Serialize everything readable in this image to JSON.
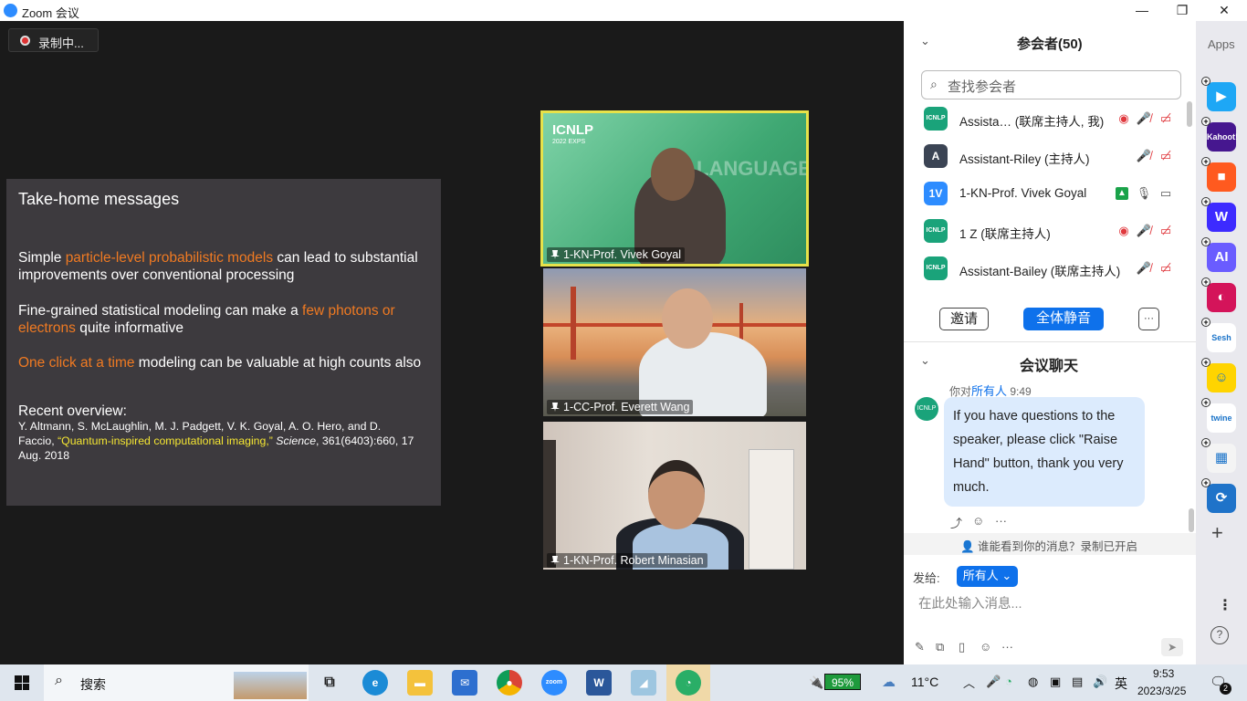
{
  "window": {
    "title": "Zoom 会议",
    "minimize": "—",
    "restore": "❐",
    "close": "✕"
  },
  "recording": {
    "label": "录制中..."
  },
  "slide": {
    "heading": "Take-home messages",
    "p1": {
      "a": "Simple ",
      "b": "particle-level probabilistic models",
      "c": " can lead to substantial improvements over conventional processing"
    },
    "p2": {
      "a": "Fine-grained statistical modeling can make a ",
      "b": "few photons or electrons",
      "c": " quite informative"
    },
    "p3": {
      "b": "One click at a time",
      "c": " modeling can be valuable at high counts also"
    },
    "overview_title": "Recent overview:",
    "ref": {
      "authors": "  Y. Altmann, S. McLaughlin, M. J. Padgett, V. K. Goyal, A. O. Hero, and D. Faccio, ",
      "title": "“Quantum-inspired computational imaging,”",
      "journal": " Science",
      "rest": ", 361(6403):660, 17 Aug. 2018"
    }
  },
  "videos": [
    {
      "label": "1-KN-Prof. Vivek Goyal",
      "banner": "ICNLP",
      "banner_year": "2022 EXPS",
      "bg_word": "LANGUAGE"
    },
    {
      "label": "1-CC-Prof. Everett Wang"
    },
    {
      "label": "1-KN-Prof. Robert Minasian"
    }
  ],
  "participants": {
    "title": "参会者(50)",
    "search_placeholder": "查找参会者",
    "list": [
      {
        "avatar": "ICNLP",
        "name": "Assista… (联席主持人, 我)",
        "color": "#1aa37a"
      },
      {
        "avatar": "A",
        "name": "Assistant-Riley (主持人)",
        "color": "#3b4454"
      },
      {
        "avatar": "1V",
        "name": "1-KN-Prof. Vivek Goyal",
        "color": "#2d8cff"
      },
      {
        "avatar": "ICNLP",
        "name": "1 Z (联席主持人)",
        "color": "#1aa37a"
      },
      {
        "avatar": "ICNLP",
        "name": "Assistant-Bailey (联席主持人)",
        "color": "#1aa37a"
      }
    ],
    "invite": "邀请",
    "mute_all": "全体静音",
    "more": "···"
  },
  "chat": {
    "title": "会议聊天",
    "from_prefix": "你对",
    "to": "所有人",
    "time": "9:49",
    "message": "If you have questions to the speaker, please click \"Raise Hand\" button, thank you very much.",
    "who_can_see": "谁能看到你的消息？录制已开启",
    "send_to_label": "发给:",
    "send_to_value": "所有人",
    "input_placeholder": "在此处输入消息..."
  },
  "apps": {
    "title": "Apps",
    "items": [
      {
        "name": "pointer-app-icon",
        "color": "#1ea7f5",
        "text": "▶"
      },
      {
        "name": "kahoot-icon",
        "color": "#46178f",
        "text": "Kahoot!"
      },
      {
        "name": "orange-app-icon",
        "color": "#ff5a1f",
        "text": "■"
      },
      {
        "name": "w-app-icon",
        "color": "#3d2bff",
        "text": "W"
      },
      {
        "name": "ai-app-icon",
        "color": "#6a5cff",
        "text": "AI"
      },
      {
        "name": "stream-app-icon",
        "color": "#d4145a",
        "text": "◐"
      },
      {
        "name": "sesh-icon",
        "color": "#ffffff",
        "text": "Sesh"
      },
      {
        "name": "smile-app-icon",
        "color": "#ffd400",
        "text": "☺"
      },
      {
        "name": "twine-icon",
        "color": "#ffffff",
        "text": "twine"
      },
      {
        "name": "grid-app-icon",
        "color": "#f4f4f4",
        "text": "▦"
      },
      {
        "name": "sync-app-icon",
        "color": "#1f73c9",
        "text": "⟳"
      }
    ]
  },
  "taskbar": {
    "search": "搜索",
    "battery": "95%",
    "weather": "11°C",
    "ime": "英",
    "time": "9:53",
    "date": "2023/3/25",
    "notif": "2"
  }
}
